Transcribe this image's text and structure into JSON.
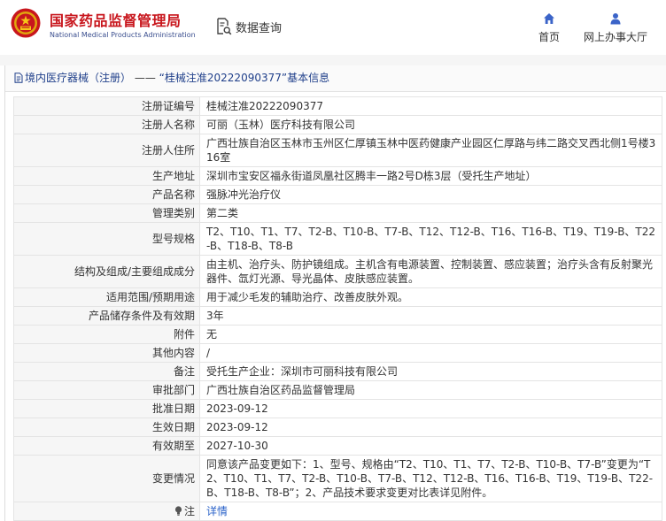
{
  "header": {
    "org_name_cn": "国家药品监督管理局",
    "org_name_en": "National Medical Products Administration",
    "search_label": "数据查询",
    "nav": [
      {
        "label": "首页",
        "icon": "home-icon"
      },
      {
        "label": "网上办事大厅",
        "icon": "person-icon"
      }
    ]
  },
  "colors": {
    "brand_red": "#c8161d",
    "brand_blue": "#3b4f8f",
    "link_blue": "#2a62c9",
    "title_blue": "#1f3f8a"
  },
  "panel": {
    "title_prefix": "境内医疗器械（注册）",
    "title_sep": "——",
    "title_main": "“桂械注准20222090377”基本信息"
  },
  "rows": [
    {
      "label": "注册证编号",
      "value": "桂械注准20222090377"
    },
    {
      "label": "注册人名称",
      "value": "可丽（玉林）医疗科技有限公司"
    },
    {
      "label": "注册人住所",
      "value": "广西壮族自治区玉林市玉州区仁厚镇玉林中医药健康产业园区仁厚路与纬二路交叉西北侧1号楼316室"
    },
    {
      "label": "生产地址",
      "value": "深圳市宝安区福永街道凤凰社区腾丰一路2号D栋3层（受托生产地址）"
    },
    {
      "label": "产品名称",
      "value": "强脉冲光治疗仪"
    },
    {
      "label": "管理类别",
      "value": "第二类"
    },
    {
      "label": "型号规格",
      "value": "T2、T10、T1、T7、T2-B、T10-B、T7-B、T12、T12-B、T16、T16-B、T19、T19-B、T22-B、T18-B、T8-B"
    },
    {
      "label": "结构及组成/主要组成成分",
      "value": "由主机、治疗头、防护镜组成。主机含有电源装置、控制装置、感应装置；治疗头含有反射聚光器件、氙灯光源、导光晶体、皮肤感应装置。"
    },
    {
      "label": "适用范围/预期用途",
      "value": "用于减少毛发的辅助治疗、改善皮肤外观。"
    },
    {
      "label": "产品储存条件及有效期",
      "value": "3年"
    },
    {
      "label": "附件",
      "value": "无"
    },
    {
      "label": "其他内容",
      "value": "/"
    },
    {
      "label": "备注",
      "value": "受托生产企业：深圳市可丽科技有限公司"
    },
    {
      "label": "审批部门",
      "value": "广西壮族自治区药品监督管理局"
    },
    {
      "label": "批准日期",
      "value": "2023-09-12"
    },
    {
      "label": "生效日期",
      "value": "2023-09-12"
    },
    {
      "label": "有效期至",
      "value": "2027-10-30"
    },
    {
      "label": "变更情况",
      "value": "同意该产品变更如下：1、型号、规格由“T2、T10、T1、T7、T2-B、T10-B、T7-B”变更为“T2、T10、T1、T7、T2-B、T10-B、T7-B、T12、T12-B、T16、T16-B、T19、T19-B、T22-B、T18-B、T8-B”；2、产品技术要求变更对比表详见附件。"
    }
  ],
  "note_row": {
    "label": "注",
    "icon": "lightbulb-icon",
    "link_text": "详情"
  }
}
